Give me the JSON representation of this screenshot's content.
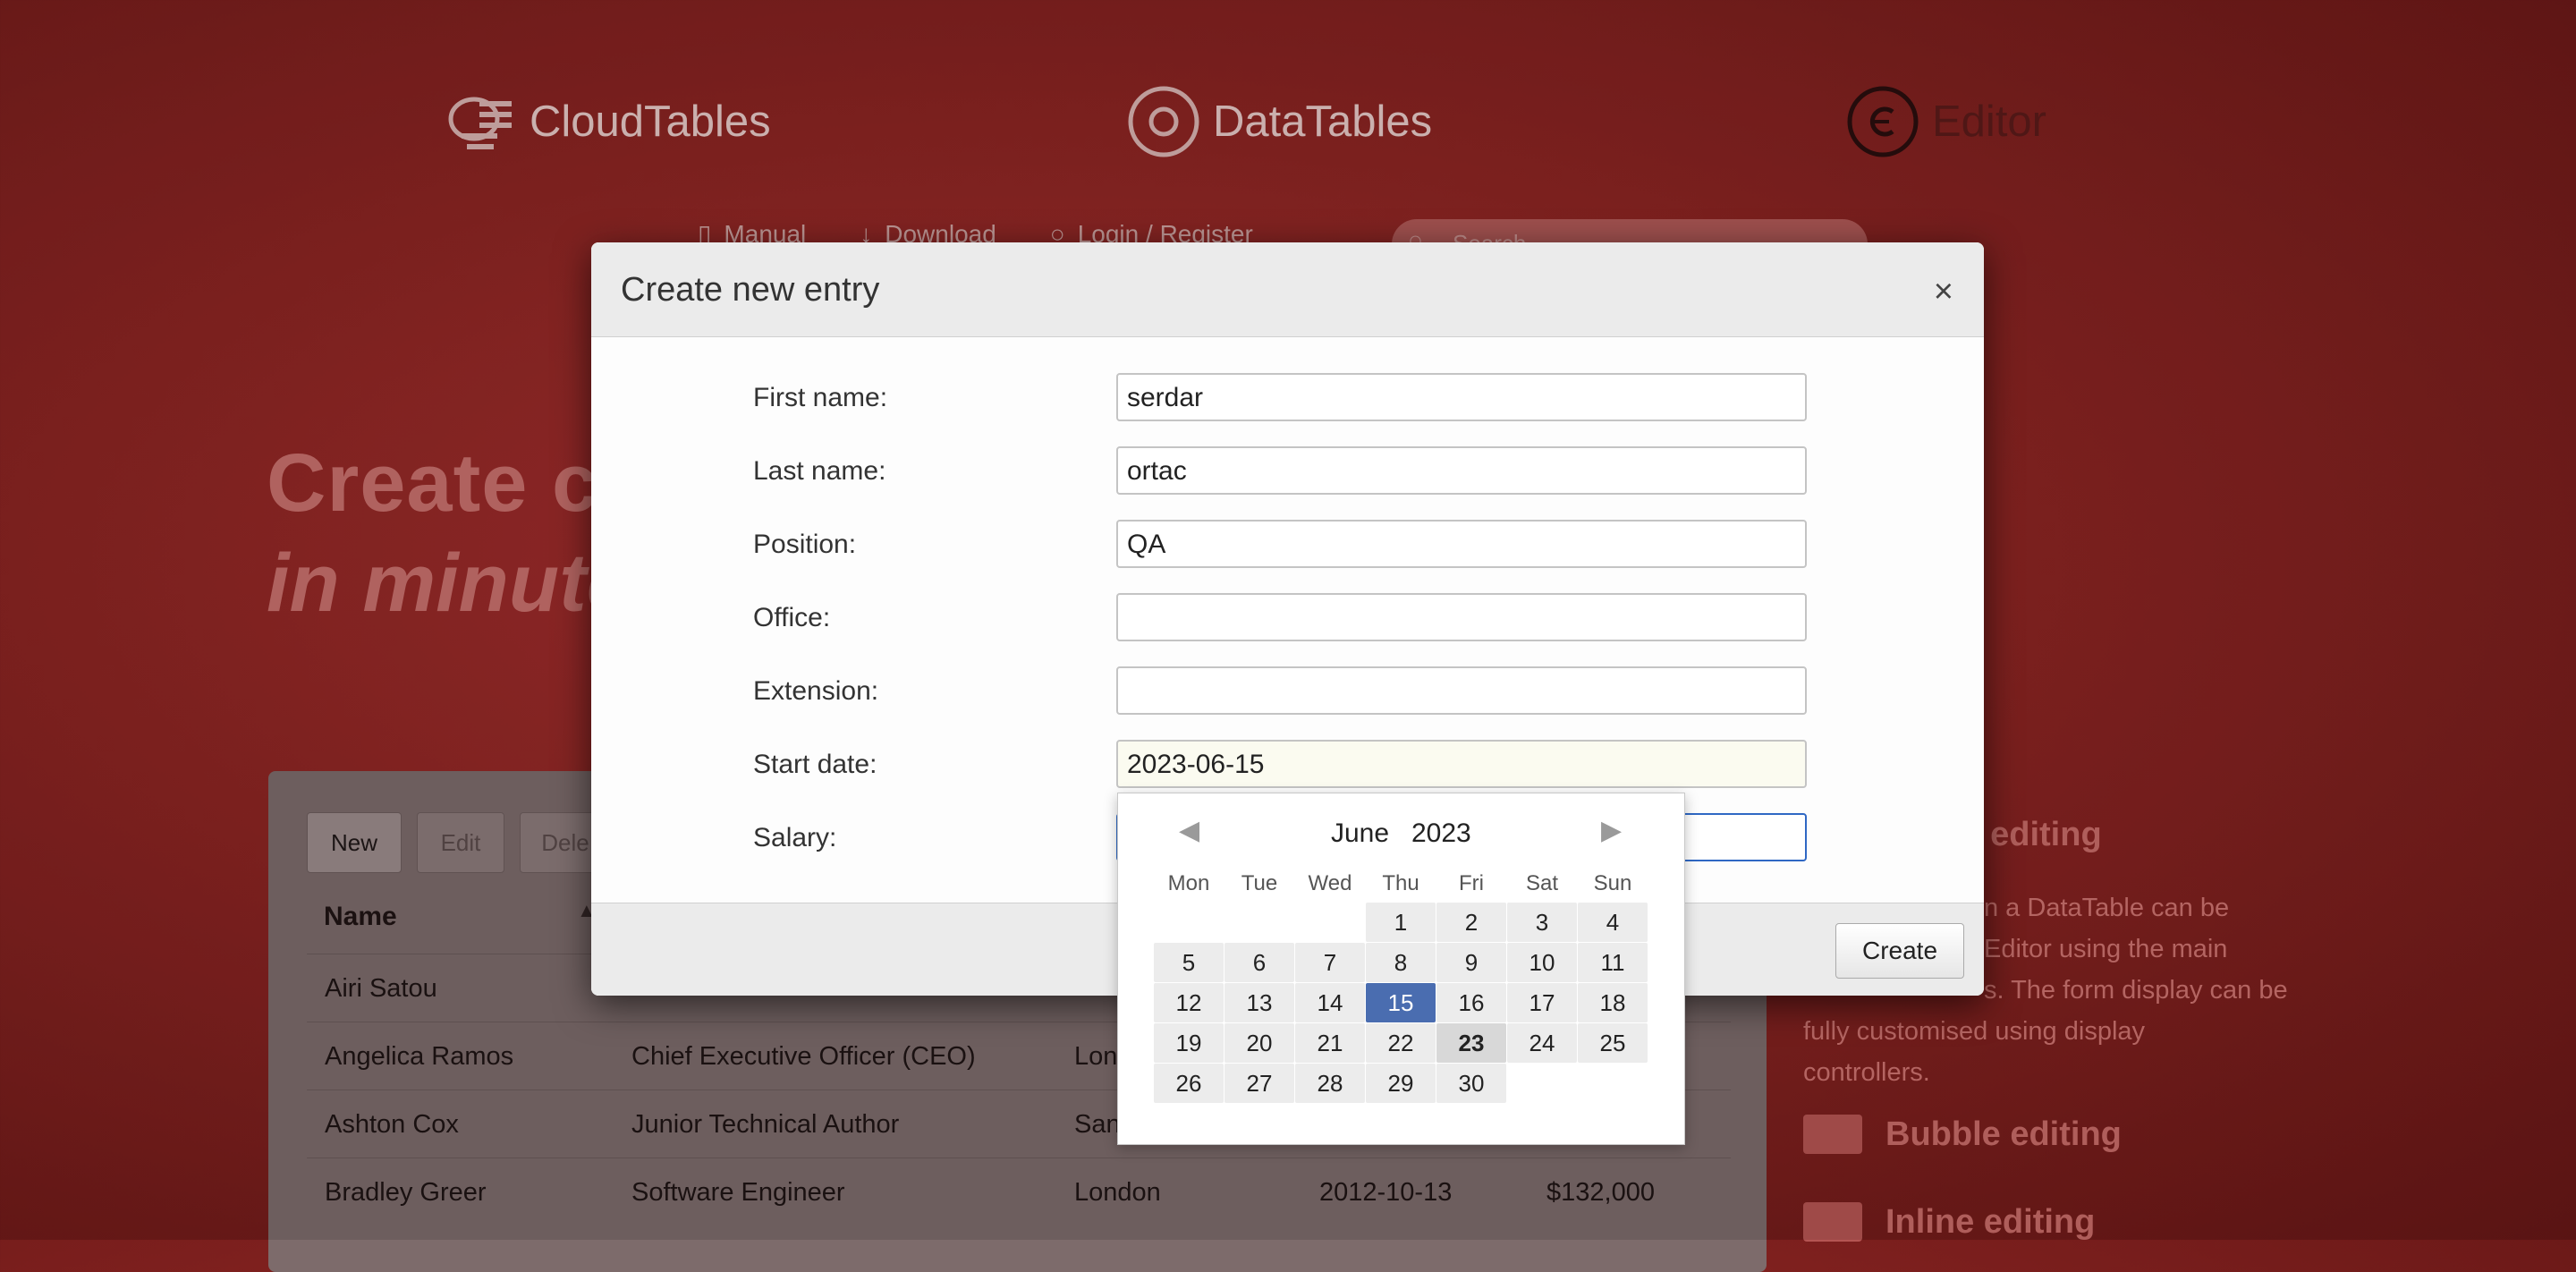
{
  "brands": {
    "cloudtables": "CloudTables",
    "datatables": "DataTables",
    "editor": "Editor"
  },
  "topnav": {
    "manual": "Manual",
    "download": "Download",
    "login": "Login / Register",
    "search_placeholder": "Search"
  },
  "hero": {
    "line1": "Create cu",
    "line2": "in minute"
  },
  "table_toolbar": {
    "new": "New",
    "edit": "Edit",
    "delete": "Dele"
  },
  "table": {
    "header_name": "Name",
    "rows": [
      {
        "name": "Airi Satou",
        "position": "",
        "office": "",
        "start": "",
        "salary": ""
      },
      {
        "name": "Angelica Ramos",
        "position": "Chief Executive Officer (CEO)",
        "office": "Lon",
        "start": "",
        "salary": ""
      },
      {
        "name": "Ashton Cox",
        "position": "Junior Technical Author",
        "office": "San",
        "start": "",
        "salary": ""
      },
      {
        "name": "Bradley Greer",
        "position": "Software Engineer",
        "office": "London",
        "start": "2012-10-13",
        "salary": "$132,000"
      }
    ]
  },
  "side": {
    "feature1_title": "w editing",
    "desc_line1": "n a DataTable can be",
    "desc_line2": "Editor using the main",
    "desc_line3": "s. The form display can be",
    "desc_line4": "fully customised using display",
    "desc_line5": "controllers.",
    "bubble": "Bubble editing",
    "inline": "Inline editing"
  },
  "modal": {
    "title": "Create new entry",
    "close": "×",
    "create_button": "Create",
    "fields": [
      {
        "label": "First name:",
        "value": "serdar"
      },
      {
        "label": "Last name:",
        "value": "ortac"
      },
      {
        "label": "Position:",
        "value": "QA"
      },
      {
        "label": "Office:",
        "value": ""
      },
      {
        "label": "Extension:",
        "value": ""
      },
      {
        "label": "Start date:",
        "value": "2023-06-15"
      },
      {
        "label": "Salary:",
        "value": ""
      }
    ]
  },
  "datepicker": {
    "month": "June",
    "year": "2023",
    "weekdays": [
      "Mon",
      "Tue",
      "Wed",
      "Thu",
      "Fri",
      "Sat",
      "Sun"
    ],
    "selected_day": "15",
    "today_day": "23"
  }
}
